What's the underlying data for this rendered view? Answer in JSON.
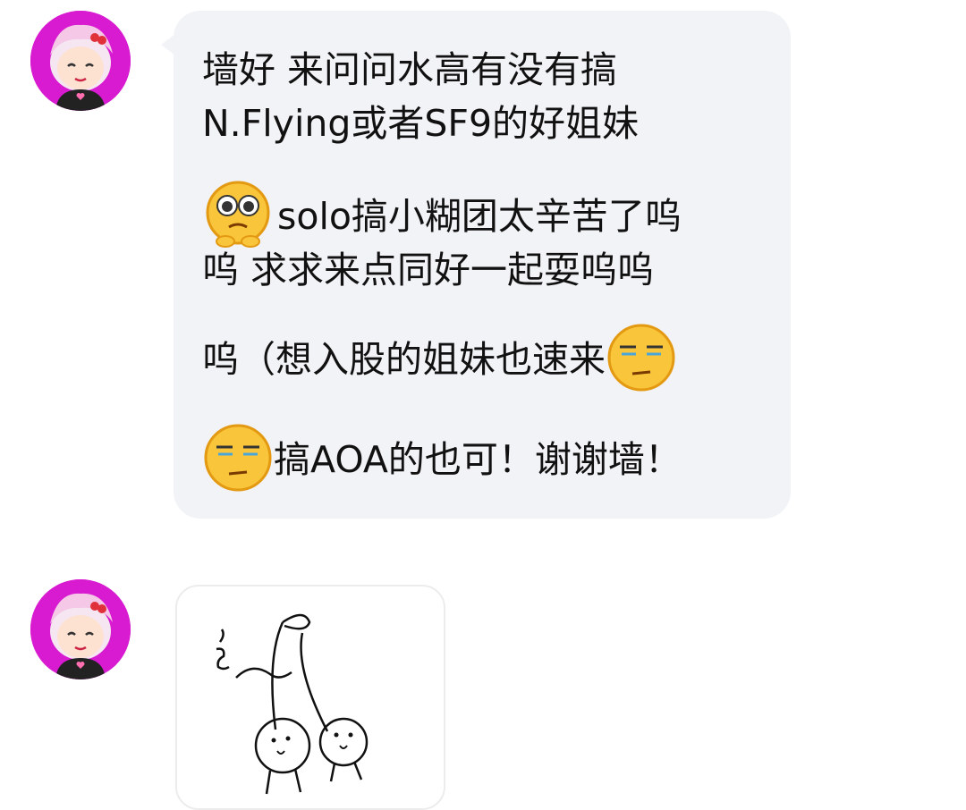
{
  "messages": [
    {
      "lines": [
        "墙好 来问问水高有没有搞",
        "N.Flying或者SF9的好姐妹",
        "solo搞小糊团太辛苦了呜",
        "呜 求求来点同好一起耍呜呜",
        "呜（想入股的姐妹也速来",
        "搞AOA的也可！谢谢墙！"
      ],
      "emojis": [
        "pleading-face-emoji",
        "smirk-face-emoji",
        "smirk-face-emoji"
      ]
    },
    {
      "sticker": "cherry-doodle-sticker"
    }
  ],
  "colors": {
    "bubble": "#f2f3f7",
    "avatar_bg": "#d81bd1",
    "text": "#111111"
  }
}
